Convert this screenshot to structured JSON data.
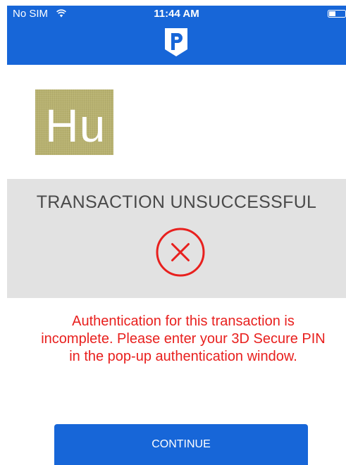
{
  "status_bar": {
    "carrier": "No SIM",
    "time": "11:44 AM"
  },
  "header": {
    "logo_icon": "brand-p-logo-icon",
    "accent_color": "#1766d8"
  },
  "merchant": {
    "logo_text": "Hu",
    "logo_color": "#b8b270"
  },
  "result": {
    "title": "TRANSACTION UNSUCCESSFUL",
    "icon": "error-circle-x-icon",
    "icon_color": "#e8201e"
  },
  "message": {
    "text": "Authentication for this transaction is incomplete. Please enter your 3D Secure PIN in the pop-up authentication window.",
    "color": "#e8201e"
  },
  "actions": {
    "continue_label": "CONTINUE"
  }
}
